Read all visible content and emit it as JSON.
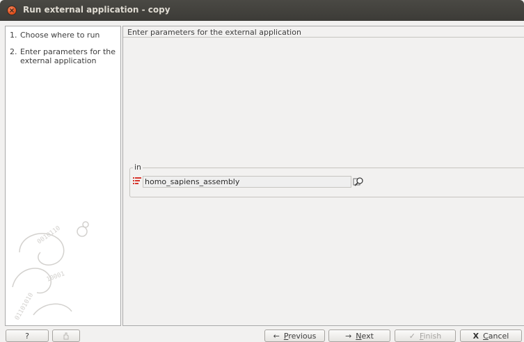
{
  "window": {
    "title": "Run external application - copy"
  },
  "steps": [
    {
      "num": "1.",
      "label": "Choose where to run"
    },
    {
      "num": "2.",
      "label": "Enter parameters for the external application"
    }
  ],
  "main": {
    "panel_title": "Enter parameters for the external application",
    "group_label": "in",
    "input_value": "homo_sapiens_assembly"
  },
  "buttons": {
    "help": "?",
    "previous_arrow": "←",
    "previous_key": "P",
    "previous_rest": "revious",
    "next_arrow": "→",
    "next_key": "N",
    "next_rest": "ext",
    "finish_check": "✓",
    "finish_key": "F",
    "finish_rest": "inish",
    "cancel_x": "X",
    "cancel_key": "C",
    "cancel_rest": "ancel"
  },
  "icons": {
    "close": "close-icon",
    "list": "element-list-icon",
    "browse": "browse-search-icon",
    "tip": "tip-icon"
  },
  "colors": {
    "titlebar": "#3c3b37",
    "close": "#df4b16",
    "list_icon": "#d7342b"
  }
}
